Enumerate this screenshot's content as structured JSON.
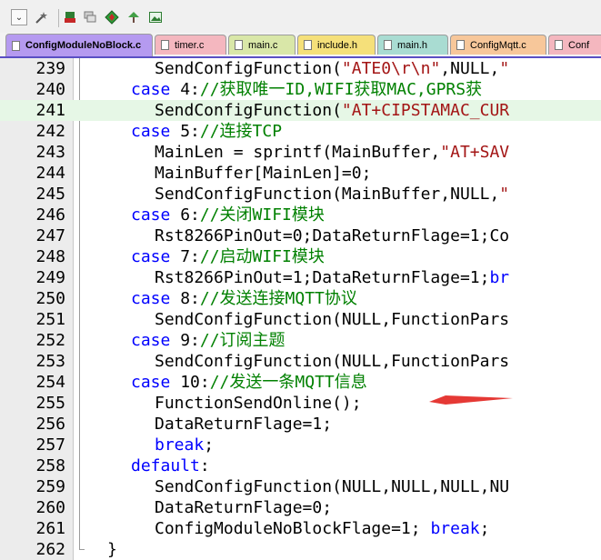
{
  "toolbar": {
    "icons": [
      "dropdown-icon",
      "wand-icon",
      "bookmark-icon",
      "layers-icon",
      "diamond-icon",
      "tree-icon",
      "image-icon"
    ],
    "dropdown_glyph": "⌄"
  },
  "tabs": [
    {
      "label": "ConfigModuleNoBlock.c",
      "active": true,
      "color": "#b59af0"
    },
    {
      "label": "timer.c",
      "active": false,
      "color": "#f4b7bf"
    },
    {
      "label": "main.c",
      "active": false,
      "color": "#d9e7a8"
    },
    {
      "label": "include.h",
      "active": false,
      "color": "#f5e07a"
    },
    {
      "label": "main.h",
      "active": false,
      "color": "#a9dcd2"
    },
    {
      "label": "ConfigMqtt.c",
      "active": false,
      "color": "#f7c79a"
    },
    {
      "label": "Conf",
      "active": false,
      "color": "#f4b7bf"
    }
  ],
  "colors": {
    "keyword": "#0000ff",
    "comment": "#008000",
    "string": "#a31515",
    "highlight": "#e6f7e6",
    "arrow": "#e53935"
  },
  "lines": [
    {
      "num": "239",
      "indent": 4,
      "segs": [
        [
          "n",
          "SendConfigFunction("
        ],
        [
          "s",
          "\"ATE0\\r\\n\""
        ],
        [
          "n",
          ",NULL,"
        ],
        [
          "s",
          "\""
        ]
      ]
    },
    {
      "num": "240",
      "indent": 3,
      "segs": [
        [
          "k",
          "case"
        ],
        [
          "n",
          " 4:"
        ],
        [
          "c",
          "//获取唯一ID,WIFI获取MAC,GPRS获"
        ]
      ]
    },
    {
      "num": "241",
      "indent": 4,
      "hl": true,
      "segs": [
        [
          "n",
          "SendConfigFunction("
        ],
        [
          "s",
          "\"AT+CIPSTAMAC_CUR"
        ]
      ]
    },
    {
      "num": "242",
      "indent": 3,
      "segs": [
        [
          "k",
          "case"
        ],
        [
          "n",
          " 5:"
        ],
        [
          "c",
          "//连接TCP"
        ]
      ]
    },
    {
      "num": "243",
      "indent": 4,
      "segs": [
        [
          "n",
          "MainLen = sprintf(MainBuffer,"
        ],
        [
          "s",
          "\"AT+SAV"
        ]
      ]
    },
    {
      "num": "244",
      "indent": 4,
      "segs": [
        [
          "n",
          "MainBuffer[MainLen]=0;"
        ]
      ]
    },
    {
      "num": "245",
      "indent": 4,
      "segs": [
        [
          "n",
          "SendConfigFunction(MainBuffer,NULL,"
        ],
        [
          "s",
          "\""
        ]
      ]
    },
    {
      "num": "246",
      "indent": 3,
      "segs": [
        [
          "k",
          "case"
        ],
        [
          "n",
          " 6:"
        ],
        [
          "c",
          "//关闭WIFI模块"
        ]
      ]
    },
    {
      "num": "247",
      "indent": 4,
      "segs": [
        [
          "n",
          "Rst8266PinOut=0;DataReturnFlage=1;Co"
        ]
      ]
    },
    {
      "num": "248",
      "indent": 3,
      "segs": [
        [
          "k",
          "case"
        ],
        [
          "n",
          " 7:"
        ],
        [
          "c",
          "//启动WIFI模块"
        ]
      ]
    },
    {
      "num": "249",
      "indent": 4,
      "segs": [
        [
          "n",
          "Rst8266PinOut=1;DataReturnFlage=1;"
        ],
        [
          "k",
          "br"
        ]
      ]
    },
    {
      "num": "250",
      "indent": 3,
      "segs": [
        [
          "k",
          "case"
        ],
        [
          "n",
          " 8:"
        ],
        [
          "c",
          "//发送连接MQTT协议"
        ]
      ]
    },
    {
      "num": "251",
      "indent": 4,
      "segs": [
        [
          "n",
          "SendConfigFunction(NULL,FunctionPars"
        ]
      ]
    },
    {
      "num": "252",
      "indent": 3,
      "segs": [
        [
          "k",
          "case"
        ],
        [
          "n",
          " 9:"
        ],
        [
          "c",
          "//订阅主题"
        ]
      ]
    },
    {
      "num": "253",
      "indent": 4,
      "segs": [
        [
          "n",
          "SendConfigFunction(NULL,FunctionPars"
        ]
      ]
    },
    {
      "num": "254",
      "indent": 3,
      "segs": [
        [
          "k",
          "case"
        ],
        [
          "n",
          " 10:"
        ],
        [
          "c",
          "//发送一条MQTT信息"
        ]
      ]
    },
    {
      "num": "255",
      "indent": 4,
      "segs": [
        [
          "n",
          "FunctionSendOnline();"
        ]
      ]
    },
    {
      "num": "256",
      "indent": 4,
      "segs": [
        [
          "n",
          "DataReturnFlage=1;"
        ]
      ]
    },
    {
      "num": "257",
      "indent": 4,
      "segs": [
        [
          "k",
          "break"
        ],
        [
          "n",
          ";"
        ]
      ]
    },
    {
      "num": "258",
      "indent": 3,
      "segs": [
        [
          "k",
          "default"
        ],
        [
          "n",
          ":"
        ]
      ]
    },
    {
      "num": "259",
      "indent": 4,
      "segs": [
        [
          "n",
          "SendConfigFunction(NULL,NULL,NULL,NU"
        ]
      ]
    },
    {
      "num": "260",
      "indent": 4,
      "segs": [
        [
          "n",
          "DataReturnFlage=0;"
        ]
      ]
    },
    {
      "num": "261",
      "indent": 4,
      "segs": [
        [
          "n",
          "ConfigModuleNoBlockFlage=1; "
        ],
        [
          "k",
          "break"
        ],
        [
          "n",
          ";"
        ]
      ]
    },
    {
      "num": "262",
      "indent": 2,
      "segs": [
        [
          "n",
          "}"
        ]
      ]
    }
  ]
}
